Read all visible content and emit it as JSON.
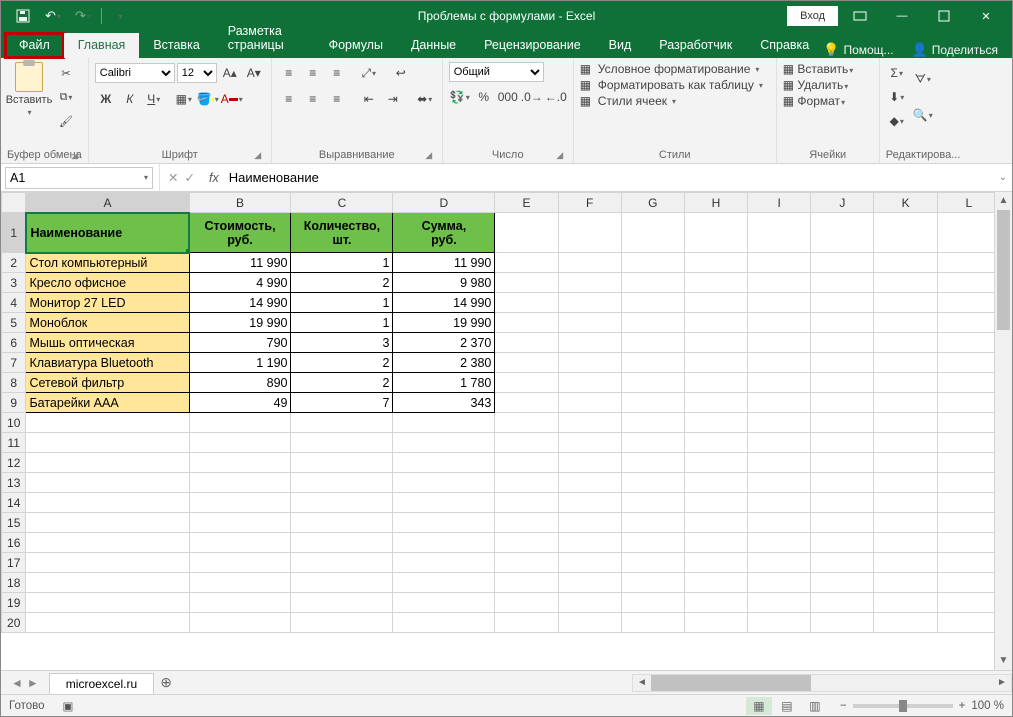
{
  "titlebar": {
    "title": "Проблемы с формулами  -  Excel",
    "login": "Вход"
  },
  "tabs": {
    "file": "Файл",
    "items": [
      "Главная",
      "Вставка",
      "Разметка страницы",
      "Формулы",
      "Данные",
      "Рецензирование",
      "Вид",
      "Разработчик",
      "Справка"
    ],
    "help": "Помощ...",
    "share": "Поделиться"
  },
  "ribbon": {
    "clipboard": {
      "paste": "Вставить",
      "label": "Буфер обмена"
    },
    "font": {
      "name": "Calibri",
      "size": "12",
      "bold": "Ж",
      "italic": "К",
      "underline": "Ч",
      "label": "Шрифт"
    },
    "align": {
      "label": "Выравнивание"
    },
    "number": {
      "format": "Общий",
      "label": "Число"
    },
    "styles": {
      "cond": "Условное форматирование",
      "table": "Форматировать как таблицу",
      "cell": "Стили ячеек",
      "label": "Стили"
    },
    "cells": {
      "insert": "Вставить",
      "delete": "Удалить",
      "format": "Формат",
      "label": "Ячейки"
    },
    "editing": {
      "label": "Редактирова..."
    }
  },
  "formulabar": {
    "name": "A1",
    "formula": "Наименование"
  },
  "columns": [
    "A",
    "B",
    "C",
    "D",
    "E",
    "F",
    "G",
    "H",
    "I",
    "J",
    "K",
    "L"
  ],
  "headers": {
    "a": "Наименование",
    "b1": "Стоимость,",
    "b2": "руб.",
    "c1": "Количество,",
    "c2": "шт.",
    "d1": "Сумма,",
    "d2": "руб."
  },
  "rows": [
    {
      "n": "2",
      "name": "Стол компьютерный",
      "cost": "11 990",
      "qty": "1",
      "sum": "11 990"
    },
    {
      "n": "3",
      "name": "Кресло офисное",
      "cost": "4 990",
      "qty": "2",
      "sum": "9 980"
    },
    {
      "n": "4",
      "name": "Монитор 27 LED",
      "cost": "14 990",
      "qty": "1",
      "sum": "14 990"
    },
    {
      "n": "5",
      "name": "Моноблок",
      "cost": "19 990",
      "qty": "1",
      "sum": "19 990"
    },
    {
      "n": "6",
      "name": "Мышь оптическая",
      "cost": "790",
      "qty": "3",
      "sum": "2 370"
    },
    {
      "n": "7",
      "name": "Клавиатура Bluetooth",
      "cost": "1 190",
      "qty": "2",
      "sum": "2 380"
    },
    {
      "n": "8",
      "name": "Сетевой фильтр",
      "cost": "890",
      "qty": "2",
      "sum": "1 780"
    },
    {
      "n": "9",
      "name": "Батарейки AAA",
      "cost": "49",
      "qty": "7",
      "sum": "343"
    }
  ],
  "emptyRows": [
    "10",
    "11",
    "12",
    "13",
    "14",
    "15",
    "16",
    "17",
    "18",
    "19",
    "20"
  ],
  "sheet": {
    "name": "microexcel.ru"
  },
  "status": {
    "ready": "Готово",
    "zoom": "100 %"
  }
}
